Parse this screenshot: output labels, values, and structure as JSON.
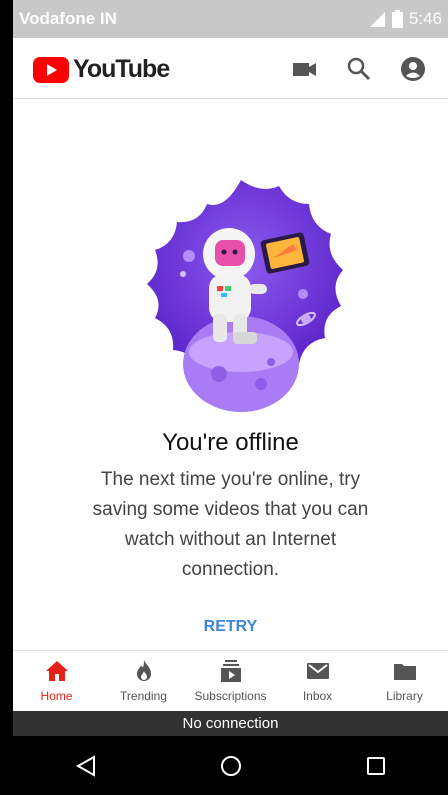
{
  "status_bar": {
    "carrier": "Vodafone IN",
    "time": "5:46"
  },
  "app_bar": {
    "logo_text": "YouTube",
    "icons": [
      "video-camera-icon",
      "search-icon",
      "account-icon"
    ]
  },
  "offline": {
    "title": "You're offline",
    "message": "The next time you're online, try saving some videos that you can watch without an Internet connection.",
    "retry_label": "RETRY"
  },
  "bottom_nav": {
    "items": [
      {
        "label": "Home",
        "icon": "home-icon",
        "active": true
      },
      {
        "label": "Trending",
        "icon": "trending-flame-icon",
        "active": false
      },
      {
        "label": "Subscriptions",
        "icon": "subscriptions-icon",
        "active": false
      },
      {
        "label": "Inbox",
        "icon": "inbox-mail-icon",
        "active": false
      },
      {
        "label": "Library",
        "icon": "library-folder-icon",
        "active": false
      }
    ]
  },
  "connection_bar": {
    "text": "No connection"
  },
  "system_nav": {
    "buttons": [
      "back-icon",
      "home-circle-icon",
      "recents-icon"
    ]
  },
  "colors": {
    "brand_red": "#ff0000",
    "active_red": "#e62117",
    "retry_blue": "#3e86d8",
    "illustration_purple": "#7b3fe4"
  }
}
